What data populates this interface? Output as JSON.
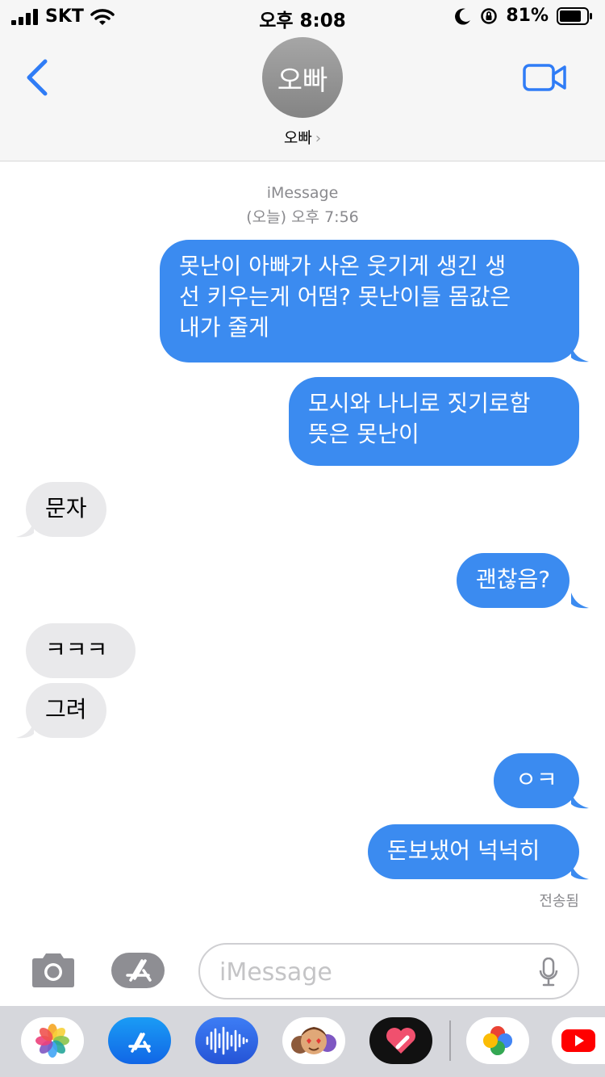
{
  "status_bar": {
    "carrier": "SKT",
    "time": "오후 8:08",
    "battery": "81%"
  },
  "header": {
    "avatar_text": "오빠",
    "contact_name": "오빠",
    "chevron": "›"
  },
  "conversation": {
    "service": "iMessage",
    "timestamp": "(오늘) 오후 7:56",
    "messages": [
      {
        "direction": "outgoing",
        "lines": [
          "못난이 아빠가 사온 웃기게 생긴 생",
          "선 키우는게 어떰? 못난이들 몸값은",
          "내가 줄게"
        ]
      },
      {
        "direction": "outgoing",
        "lines": [
          "모시와 나니로 짓기로함",
          "뜻은 못난이"
        ]
      },
      {
        "direction": "incoming",
        "lines": [
          "문자"
        ]
      },
      {
        "direction": "outgoing",
        "lines": [
          "괜찮음?"
        ]
      },
      {
        "direction": "incoming",
        "lines": [
          "ㅋㅋㅋ"
        ]
      },
      {
        "direction": "incoming",
        "lines": [
          "그려"
        ]
      },
      {
        "direction": "outgoing",
        "lines": [
          "ㅇㅋ"
        ]
      },
      {
        "direction": "outgoing",
        "lines": [
          "돈보냈어 넉넉히"
        ]
      }
    ],
    "delivered_label": "전송됨"
  },
  "composer": {
    "placeholder": "iMessage"
  },
  "app_drawer": {
    "apps": [
      "photos-app",
      "app-store-app",
      "audio-message-app",
      "memoji-app",
      "digital-touch-app",
      "google-photos-app",
      "youtube-app"
    ]
  },
  "colors": {
    "accent": "#3b8bf0",
    "incoming_bubble": "#e9e9eb",
    "header_bg": "#f6f6f6"
  }
}
